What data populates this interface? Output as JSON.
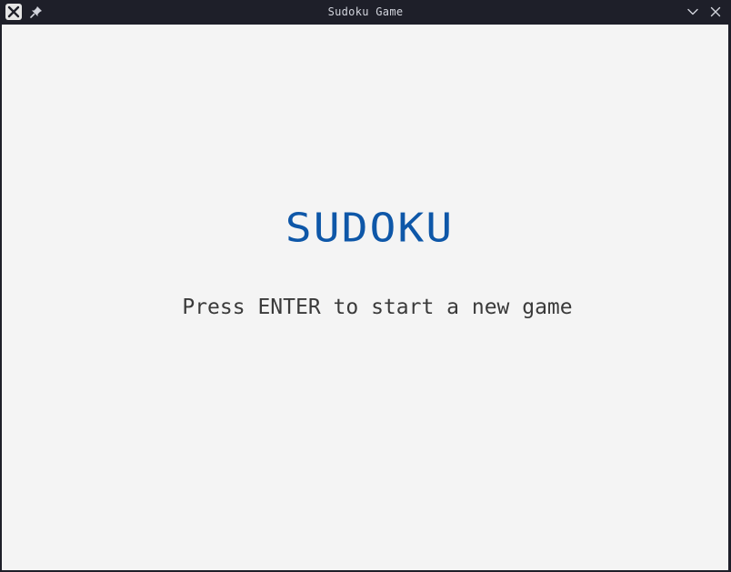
{
  "window": {
    "title": "Sudoku Game"
  },
  "icons": {
    "app": "app-x-icon",
    "pin": "pin-icon",
    "minimize": "chevron-down-icon",
    "close": "close-icon"
  },
  "colors": {
    "title_bar": "#1e1f29",
    "background": "#f4f4f4",
    "title_text": "#0e57a8",
    "prompt_text": "#3a3a3a"
  },
  "game": {
    "title": "SUDOKU",
    "prompt": "Press ENTER to start a new game"
  }
}
